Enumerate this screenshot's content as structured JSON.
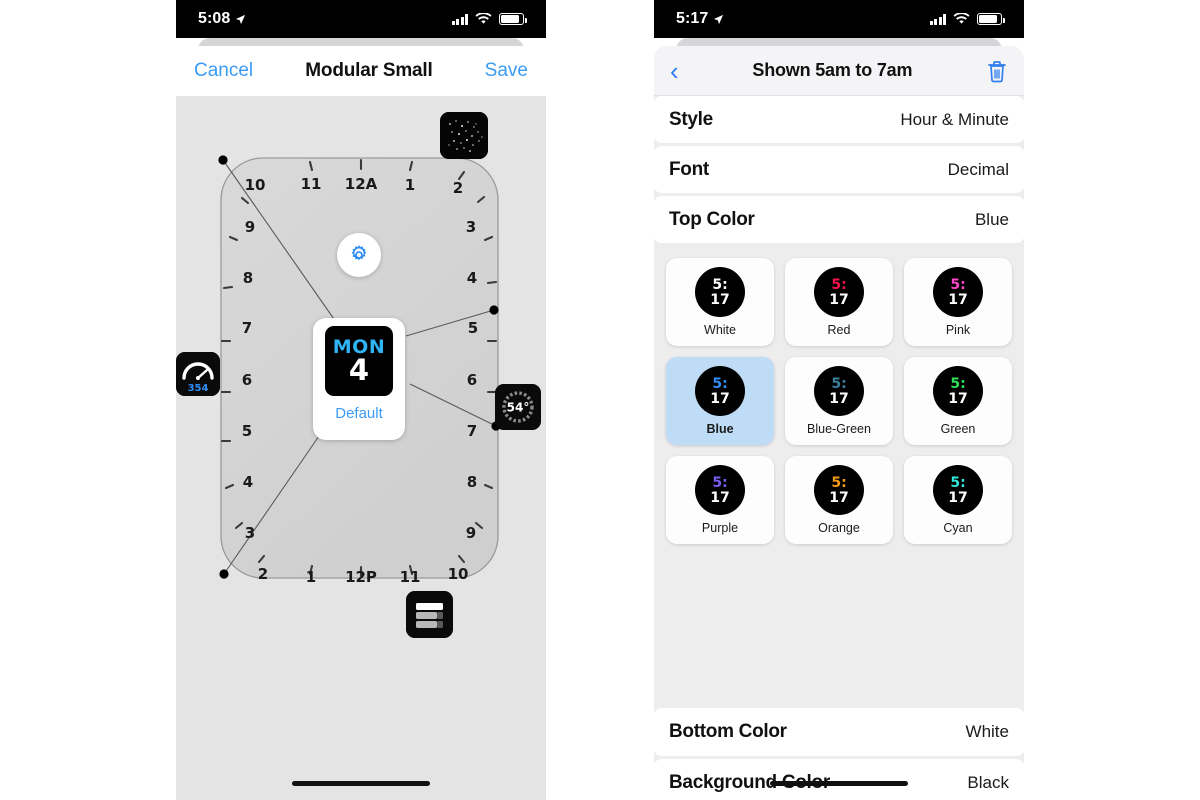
{
  "left_phone": {
    "status_bar": {
      "time": "5:08",
      "location_icon": "location-arrow-icon",
      "signal_icon": "cellular-bars-icon",
      "wifi_icon": "wifi-icon",
      "battery_icon": "battery-icon"
    },
    "nav": {
      "cancel_label": "Cancel",
      "title": "Modular Small",
      "save_label": "Save"
    },
    "editor": {
      "gear_icon": "gear-icon",
      "preview": {
        "tile_day": "MON",
        "tile_date": "4",
        "label": "Default"
      },
      "complications": [
        {
          "name": "astronomy-stars-complication",
          "value": ""
        },
        {
          "name": "speedometer-complication",
          "value": "354"
        },
        {
          "name": "temperature-dial-complication",
          "value": "54°"
        },
        {
          "name": "list-bars-complication",
          "value": ""
        }
      ],
      "hour_labels_left": [
        "10",
        "9",
        "8",
        "7",
        "6",
        "5",
        "4",
        "3",
        "2"
      ],
      "hour_labels_top": [
        "11",
        "12A",
        "1"
      ],
      "hour_labels_right": [
        "2",
        "3",
        "4",
        "5",
        "6",
        "7",
        "8",
        "9",
        "10"
      ],
      "hour_labels_bottom": [
        "1",
        "12P",
        "11"
      ]
    }
  },
  "right_phone": {
    "status_bar": {
      "time": "5:17",
      "location_icon": "location-arrow-icon",
      "signal_icon": "cellular-bars-icon",
      "wifi_icon": "wifi-icon",
      "battery_icon": "battery-icon"
    },
    "nav": {
      "back_icon": "chevron-left-icon",
      "title": "Shown 5am to 7am",
      "delete_icon": "trash-icon"
    },
    "settings": {
      "rows_top": [
        {
          "label": "Style",
          "value": "Hour & Minute"
        },
        {
          "label": "Font",
          "value": "Decimal"
        },
        {
          "label": "Top Color",
          "value": "Blue"
        }
      ],
      "rows_bottom": [
        {
          "label": "Bottom Color",
          "value": "White"
        },
        {
          "label": "Background Color",
          "value": "Black"
        }
      ],
      "swatches": [
        {
          "name": "White",
          "top_time": "5:",
          "bottom_time": "17",
          "color": "#ffffff",
          "selected": false
        },
        {
          "name": "Red",
          "top_time": "5:",
          "bottom_time": "17",
          "color": "#f4124a",
          "selected": false
        },
        {
          "name": "Pink",
          "top_time": "5:",
          "bottom_time": "17",
          "color": "#ff45c8",
          "selected": false
        },
        {
          "name": "Blue",
          "top_time": "5:",
          "bottom_time": "17",
          "color": "#2f8df5",
          "selected": true
        },
        {
          "name": "Blue-Green",
          "top_time": "5:",
          "bottom_time": "17",
          "color": "#3a7f9e",
          "selected": false
        },
        {
          "name": "Green",
          "top_time": "5:",
          "bottom_time": "17",
          "color": "#2fe05a",
          "selected": false
        },
        {
          "name": "Purple",
          "top_time": "5:",
          "bottom_time": "17",
          "color": "#7a5cf0",
          "selected": false
        },
        {
          "name": "Orange",
          "top_time": "5:",
          "bottom_time": "17",
          "color": "#f09a1a",
          "selected": false
        },
        {
          "name": "Cyan",
          "top_time": "5:",
          "bottom_time": "17",
          "color": "#2fe8d8",
          "selected": false
        }
      ]
    }
  },
  "theme": {
    "accent_blue": "#3a9bf5",
    "selection_blue": "#bfdcf7",
    "panel_gray": "#ededed",
    "canvas_gray": "#e4e4e4"
  }
}
